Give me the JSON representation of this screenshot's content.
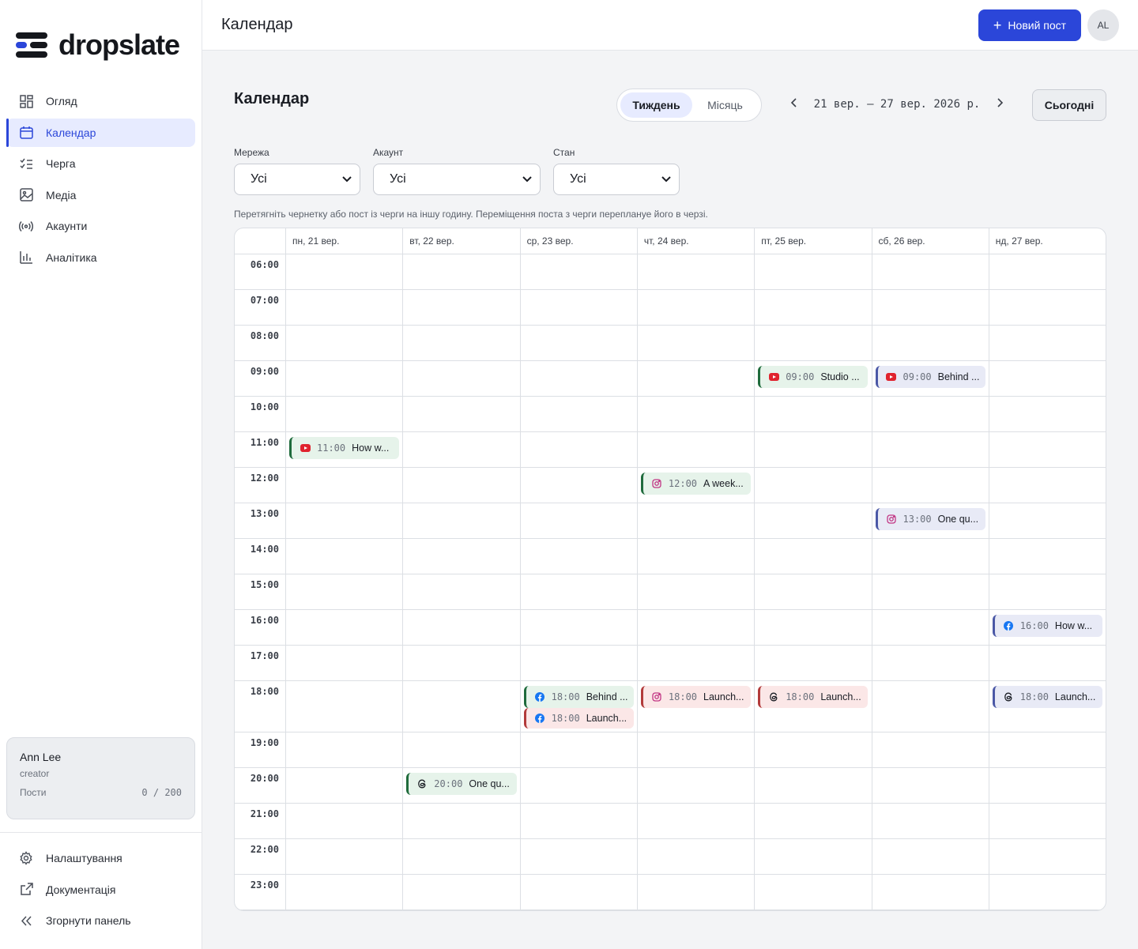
{
  "brand": {
    "name": "dropslate"
  },
  "sidebar": {
    "items": [
      {
        "label": "Огляд",
        "icon": "grid-icon"
      },
      {
        "label": "Календар",
        "icon": "calendar-icon",
        "active": true
      },
      {
        "label": "Черга",
        "icon": "queue-icon"
      },
      {
        "label": "Медіа",
        "icon": "image-icon"
      },
      {
        "label": "Акаунти",
        "icon": "broadcast-icon"
      },
      {
        "label": "Аналітика",
        "icon": "bar-chart-icon"
      }
    ],
    "user": {
      "name": "Ann Lee",
      "role": "creator",
      "posts_label": "Пости",
      "posts_value": "0 / 200"
    },
    "bottom": [
      {
        "label": "Налаштування",
        "icon": "gear-icon"
      },
      {
        "label": "Документація",
        "icon": "external-link-icon"
      },
      {
        "label": "Згорнути панель",
        "icon": "collapse-icon"
      }
    ]
  },
  "header": {
    "title": "Календар",
    "new_post_label": "Новий пост",
    "avatar_initials": "AL"
  },
  "main": {
    "title": "Календар",
    "view_toggle": {
      "week": "Тиждень",
      "month": "Місяць",
      "selected": "week"
    },
    "range_label": "21 вер. – 27 вер. 2026 р.",
    "today_label": "Сьогодні",
    "filters": {
      "network": {
        "label": "Мережа",
        "value": "Усі"
      },
      "account": {
        "label": "Акаунт",
        "value": "Усі"
      },
      "state": {
        "label": "Стан",
        "value": "Усі"
      }
    },
    "hint": "Перетягніть чернетку або пост із черги на іншу годину. Переміщення поста з черги переплануе його в черзі."
  },
  "calendar": {
    "days": [
      "пн, 21 вер.",
      "вт, 22 вер.",
      "ср, 23 вер.",
      "чт, 24 вер.",
      "пт, 25 вер.",
      "сб, 26 вер.",
      "нд, 27 вер."
    ],
    "hours": [
      "06:00",
      "07:00",
      "08:00",
      "09:00",
      "10:00",
      "11:00",
      "12:00",
      "13:00",
      "14:00",
      "15:00",
      "16:00",
      "17:00",
      "18:00",
      "19:00",
      "20:00",
      "21:00",
      "22:00",
      "23:00"
    ],
    "events": [
      {
        "day": 4,
        "hour": "09:00",
        "time": "09:00",
        "text": "Studio ...",
        "network": "youtube",
        "status": "green"
      },
      {
        "day": 5,
        "hour": "09:00",
        "time": "09:00",
        "text": "Behind ...",
        "network": "youtube",
        "status": "purple"
      },
      {
        "day": 0,
        "hour": "11:00",
        "time": "11:00",
        "text": "How w...",
        "network": "youtube",
        "status": "green"
      },
      {
        "day": 3,
        "hour": "12:00",
        "time": "12:00",
        "text": "A week...",
        "network": "instagram",
        "status": "green"
      },
      {
        "day": 5,
        "hour": "13:00",
        "time": "13:00",
        "text": "One qu...",
        "network": "instagram",
        "status": "purple"
      },
      {
        "day": 6,
        "hour": "16:00",
        "time": "16:00",
        "text": "How w...",
        "network": "facebook",
        "status": "purple"
      },
      {
        "day": 2,
        "hour": "18:00",
        "time": "18:00",
        "text": "Behind ...",
        "network": "facebook",
        "status": "green"
      },
      {
        "day": 2,
        "hour": "18:00",
        "time": "18:00",
        "text": "Launch...",
        "network": "facebook",
        "status": "red"
      },
      {
        "day": 3,
        "hour": "18:00",
        "time": "18:00",
        "text": "Launch...",
        "network": "instagram",
        "status": "red"
      },
      {
        "day": 4,
        "hour": "18:00",
        "time": "18:00",
        "text": "Launch...",
        "network": "threads",
        "status": "red"
      },
      {
        "day": 6,
        "hour": "18:00",
        "time": "18:00",
        "text": "Launch...",
        "network": "threads",
        "status": "purple"
      },
      {
        "day": 1,
        "hour": "20:00",
        "time": "20:00",
        "text": "One qu...",
        "network": "threads",
        "status": "green"
      }
    ]
  }
}
